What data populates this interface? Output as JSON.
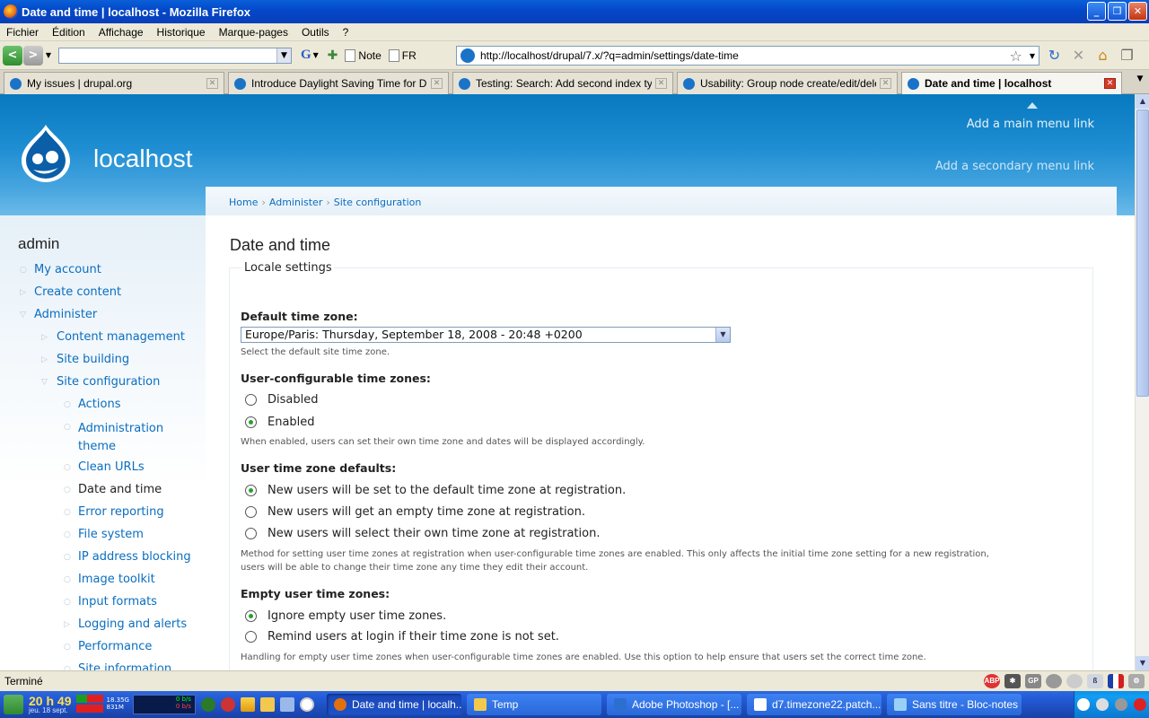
{
  "window": {
    "title": "Date and time | localhost - Mozilla Firefox"
  },
  "menubar": [
    "Fichier",
    "Édition",
    "Affichage",
    "Historique",
    "Marque-pages",
    "Outils",
    "?"
  ],
  "toolbar": {
    "note_label": "Note",
    "lang_label": "FR",
    "url": "http://localhost/drupal/7.x/?q=admin/settings/date-time"
  },
  "tabs": [
    {
      "label": "My issues | drupal.org",
      "active": false
    },
    {
      "label": "Introduce Daylight Saving Time for Dru...",
      "active": false
    },
    {
      "label": "Testing: Search: Add second index typ...",
      "active": false
    },
    {
      "label": "Usability: Group node create/edit/delet...",
      "active": false
    },
    {
      "label": "Date and time | localhost",
      "active": true
    }
  ],
  "site": {
    "name": "localhost",
    "primary_link": "Add a main menu link",
    "secondary_link": "Add a secondary menu link"
  },
  "sidebar": {
    "title": "admin",
    "items": [
      {
        "label": "My account",
        "level": 0,
        "marker": "○"
      },
      {
        "label": "Create content",
        "level": 0,
        "marker": "▷"
      },
      {
        "label": "Administer",
        "level": 0,
        "marker": "▽"
      },
      {
        "label": "Content management",
        "level": 1,
        "marker": "▷"
      },
      {
        "label": "Site building",
        "level": 1,
        "marker": "▷"
      },
      {
        "label": "Site configuration",
        "level": 1,
        "marker": "▽"
      },
      {
        "label": "Actions",
        "level": 2,
        "marker": "○"
      },
      {
        "label": "Administration theme",
        "level": 2,
        "marker": "○"
      },
      {
        "label": "Clean URLs",
        "level": 2,
        "marker": "○"
      },
      {
        "label": "Date and time",
        "level": 2,
        "marker": "○",
        "current": true
      },
      {
        "label": "Error reporting",
        "level": 2,
        "marker": "○"
      },
      {
        "label": "File system",
        "level": 2,
        "marker": "○"
      },
      {
        "label": "IP address blocking",
        "level": 2,
        "marker": "○"
      },
      {
        "label": "Image toolkit",
        "level": 2,
        "marker": "○"
      },
      {
        "label": "Input formats",
        "level": 2,
        "marker": "○"
      },
      {
        "label": "Logging and alerts",
        "level": 2,
        "marker": "▷"
      },
      {
        "label": "Performance",
        "level": 2,
        "marker": "○"
      },
      {
        "label": "Site information",
        "level": 2,
        "marker": "○"
      }
    ]
  },
  "breadcrumb": [
    "Home",
    "Administer",
    "Site configuration"
  ],
  "page": {
    "title": "Date and time",
    "fieldset_legend": "Locale settings",
    "default_tz": {
      "label": "Default time zone:",
      "value": "Europe/Paris: Thursday, September 18, 2008 - 20:48 +0200",
      "description": "Select the default site time zone."
    },
    "user_configurable": {
      "label": "User-configurable time zones:",
      "options": [
        {
          "label": "Disabled",
          "checked": false
        },
        {
          "label": "Enabled",
          "checked": true
        }
      ],
      "description": "When enabled, users can set their own time zone and dates will be displayed accordingly."
    },
    "user_defaults": {
      "label": "User time zone defaults:",
      "options": [
        {
          "label": "New users will be set to the default time zone at registration.",
          "checked": true
        },
        {
          "label": "New users will get an empty time zone at registration.",
          "checked": false
        },
        {
          "label": "New users will select their own time zone at registration.",
          "checked": false
        }
      ],
      "description_1": "Method for setting user time zones at registration when user-configurable time zones are enabled. This only affects the initial time zone setting for a new registration,",
      "description_2": "users will be able to change their time zone any time they edit their account."
    },
    "empty_tz": {
      "label": "Empty user time zones:",
      "options": [
        {
          "label": "Ignore empty user time zones.",
          "checked": true
        },
        {
          "label": "Remind users at login if their time zone is not set.",
          "checked": false
        }
      ],
      "description": "Handling for empty user time zones when user-configurable time zones are enabled. Use this option to help ensure that users set the correct time zone."
    }
  },
  "statusbar": {
    "text": "Terminé",
    "abp": "ABP",
    "gp": "GP"
  },
  "taskbar": {
    "time": "20 h 49",
    "date": "jeu. 18 sept.",
    "mem_1": "18.35G",
    "mem_2": "831M",
    "net_1": "0 b/s",
    "net_2": "0 b/s",
    "tasks": [
      {
        "label": "Date and time | localh...",
        "active": true,
        "color": "#e2700f"
      },
      {
        "label": "Temp",
        "active": false,
        "color": "#f2c94c"
      },
      {
        "label": "Adobe Photoshop - [...",
        "active": false,
        "color": "#2d6fd1"
      },
      {
        "label": "d7.timezone22.patch...",
        "active": false,
        "color": "#ffffff"
      },
      {
        "label": "Sans titre - Bloc-notes",
        "active": false,
        "color": "#9ad0f5"
      }
    ]
  },
  "colors": {
    "accent": "#0779bf",
    "link": "#0a6ec0",
    "radio_checked": "#2c9e2c"
  }
}
